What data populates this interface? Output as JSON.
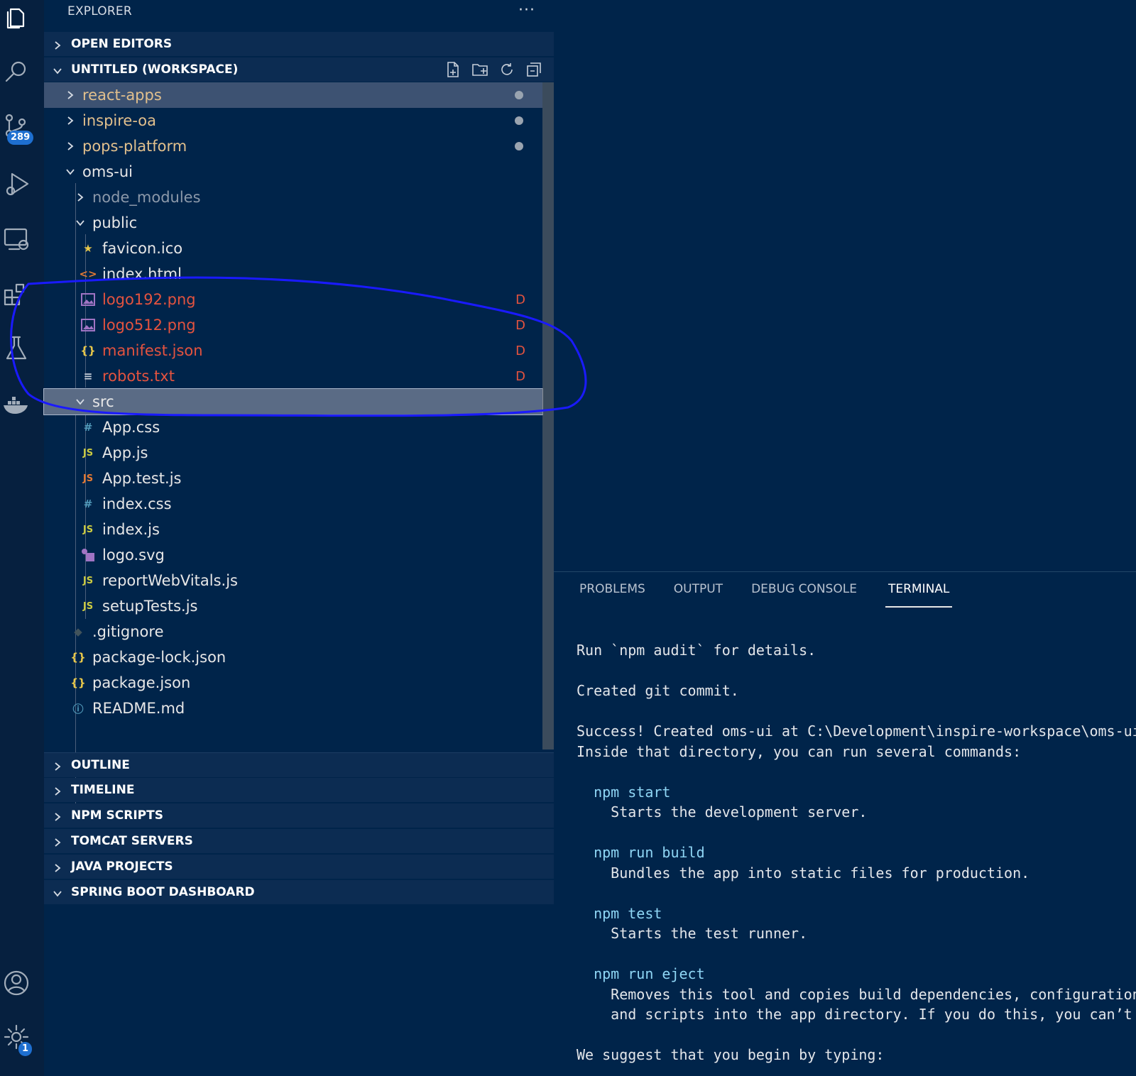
{
  "activity_bar": {
    "source_control_badge": "289",
    "settings_badge": "1",
    "icons": [
      "files-icon",
      "search-icon",
      "source-control-icon",
      "run-debug-icon",
      "remote-explorer-icon",
      "extensions-icon",
      "testing-icon",
      "docker-icon",
      "account-icon",
      "settings-gear-icon"
    ]
  },
  "explorer": {
    "title": "EXPLORER",
    "more": "···",
    "open_editors": "OPEN EDITORS",
    "workspace": "UNTITLED (WORKSPACE)"
  },
  "tree": [
    {
      "label": "react-apps",
      "type": "folder",
      "state": "collapsed"
    },
    {
      "label": "inspire-oa",
      "type": "folder",
      "state": "collapsed"
    },
    {
      "label": "pops-platform",
      "type": "folder",
      "state": "collapsed"
    },
    {
      "label": "oms-ui",
      "type": "folder",
      "state": "expanded"
    },
    {
      "label": "node_modules",
      "type": "folder",
      "state": "collapsed"
    },
    {
      "label": "public",
      "type": "folder",
      "state": "expanded"
    },
    {
      "label": "favicon.ico",
      "type": "file",
      "icon": "star-icon"
    },
    {
      "label": "index.html",
      "type": "file",
      "icon": "html-icon"
    },
    {
      "label": "logo192.png",
      "type": "file",
      "icon": "image-icon",
      "decoration": "D"
    },
    {
      "label": "logo512.png",
      "type": "file",
      "icon": "image-icon",
      "decoration": "D"
    },
    {
      "label": "manifest.json",
      "type": "file",
      "icon": "json-icon",
      "decoration": "D"
    },
    {
      "label": "robots.txt",
      "type": "file",
      "icon": "text-icon",
      "decoration": "D"
    },
    {
      "label": "src",
      "type": "folder",
      "state": "expanded"
    },
    {
      "label": "App.css",
      "type": "file",
      "icon": "css-icon"
    },
    {
      "label": "App.js",
      "type": "file",
      "icon": "js-icon"
    },
    {
      "label": "App.test.js",
      "type": "file",
      "icon": "js-test-icon"
    },
    {
      "label": "index.css",
      "type": "file",
      "icon": "css-icon"
    },
    {
      "label": "index.js",
      "type": "file",
      "icon": "js-icon"
    },
    {
      "label": "logo.svg",
      "type": "file",
      "icon": "svg-icon"
    },
    {
      "label": "reportWebVitals.js",
      "type": "file",
      "icon": "js-icon"
    },
    {
      "label": "setupTests.js",
      "type": "file",
      "icon": "js-icon"
    },
    {
      "label": ".gitignore",
      "type": "file",
      "icon": "git-icon"
    },
    {
      "label": "package-lock.json",
      "type": "file",
      "icon": "json-icon"
    },
    {
      "label": "package.json",
      "type": "file",
      "icon": "json-icon"
    },
    {
      "label": "README.md",
      "type": "file",
      "icon": "info-icon"
    }
  ],
  "sections": {
    "outline": "OUTLINE",
    "timeline": "TIMELINE",
    "npm_scripts": "NPM SCRIPTS",
    "tomcat": "TOMCAT SERVERS",
    "java_projects": "JAVA PROJECTS",
    "spring_boot": "SPRING BOOT DASHBOARD"
  },
  "panel_tabs": [
    "PROBLEMS",
    "OUTPUT",
    "DEBUG CONSOLE",
    "TERMINAL"
  ],
  "terminal": {
    "lines": [
      "Run `npm audit` for details.",
      "",
      "Created git commit.",
      "",
      "Success! Created oms-ui at C:\\Development\\inspire-workspace\\oms-ui",
      "Inside that directory, you can run several commands:",
      "",
      "  npm start",
      "    Starts the development server.",
      "",
      "  npm run build",
      "    Bundles the app into static files for production.",
      "",
      "  npm test",
      "    Starts the test runner.",
      "",
      "  npm run eject",
      "    Removes this tool and copies build dependencies, configuration files",
      "    and scripts into the app directory. If you do this, you can’t go back!",
      "",
      "We suggest that you begin by typing:"
    ]
  },
  "colors": {
    "background": "#00244a",
    "folder_modified": "#e2c08d",
    "deleted": "#e4533f",
    "command": "#8fd6f5",
    "annotation": "#1a1aff"
  }
}
